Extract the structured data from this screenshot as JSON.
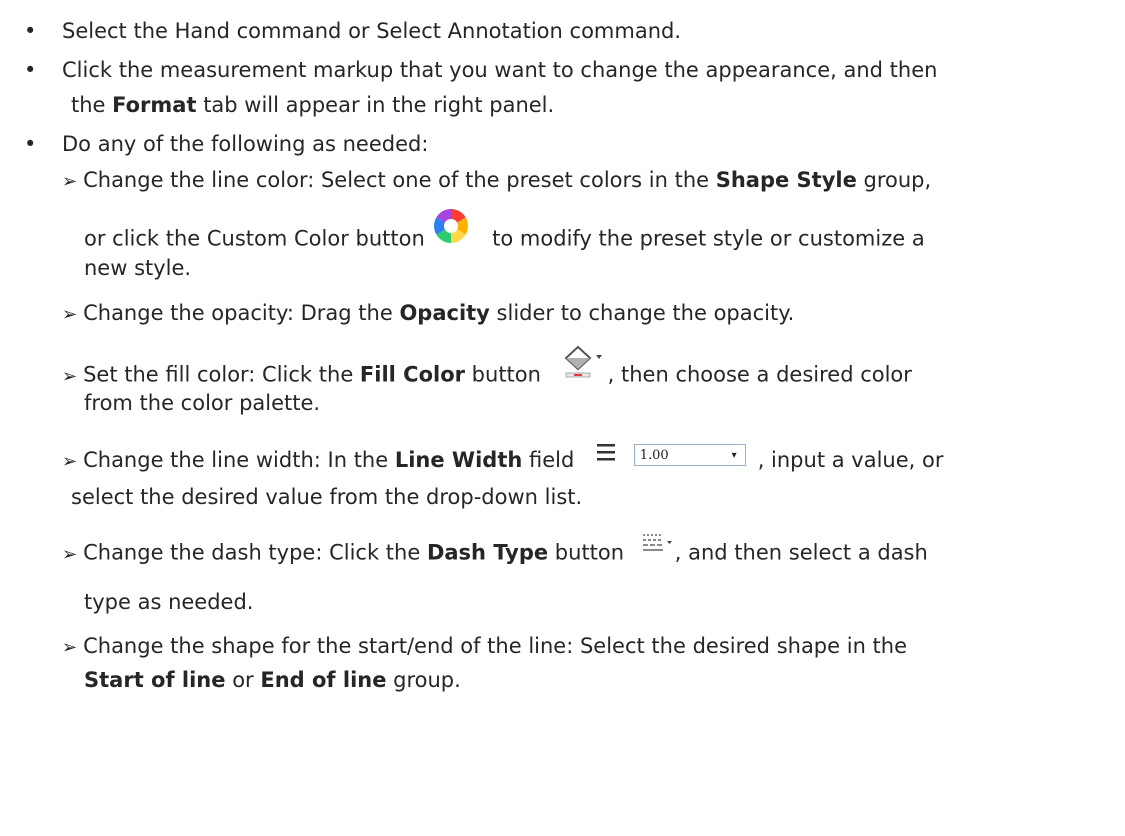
{
  "bullets": {
    "b1": "Select the Hand command or Select Annotation command.",
    "b2_line1": "Click the measurement markup that you want to change the appearance, and then",
    "b2_line2_pre": "the ",
    "b2_line2_bold": "Format",
    "b2_line2_post": " tab will appear in the right panel.",
    "b3": "Do any of the following as needed:"
  },
  "items": {
    "color_pre": "Change the line color: Select one of the preset colors in the ",
    "color_bold": "Shape Style",
    "color_post": " group,",
    "color_l2_pre": "or click the Custom Color button",
    "color_l2_post": "to modify the preset style or customize a",
    "color_l3": "new style.",
    "opacity_pre": "Change the opacity: Drag the ",
    "opacity_bold": "Opacity",
    "opacity_post": " slider to change the opacity.",
    "fill_pre": "Set the fill color: Click the ",
    "fill_bold": "Fill Color",
    "fill_mid": " button",
    "fill_post": ", then choose a desired color",
    "fill_l2": "from the color palette.",
    "width_pre": "Change the line width: In the ",
    "width_bold": "Line Width",
    "width_mid": " field",
    "width_value": "1.00",
    "width_post": ", input a value, or",
    "width_l2": "select the desired value from the drop-down list.",
    "dash_pre": "Change the dash type: Click the ",
    "dash_bold": "Dash Type",
    "dash_mid": " button",
    "dash_post": ", and then select a dash",
    "dash_l2": "type as needed.",
    "shape_l1": "Change the shape for the start/end of the line: Select the desired shape in the",
    "shape_bold1": "Start of line",
    "shape_mid": " or ",
    "shape_bold2": "End of line",
    "shape_post": " group."
  },
  "symbols": {
    "bullet": "•",
    "arrow": "➢"
  },
  "icons": [
    "custom-color-icon",
    "fill-color-icon",
    "line-width-icon",
    "dash-type-icon"
  ]
}
